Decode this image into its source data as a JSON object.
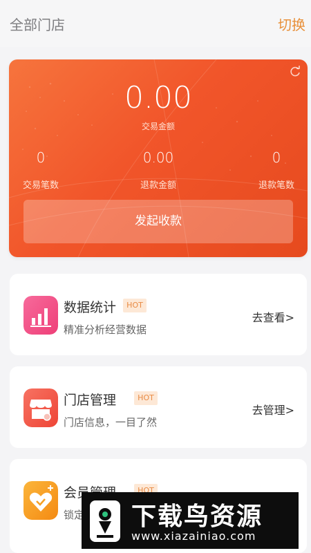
{
  "header": {
    "store_title": "全部门店",
    "switch_label": "切换"
  },
  "summary": {
    "amount_value": "0.00",
    "amount_label": "交易金额",
    "stats": [
      {
        "value": "0",
        "label": "交易笔数"
      },
      {
        "value": "0.00",
        "label": "退款金额"
      },
      {
        "value": "0",
        "label": "退款笔数"
      }
    ],
    "collect_button": "发起收款",
    "refresh_icon": "refresh-icon"
  },
  "menu": [
    {
      "title": "数据统计",
      "badge": "HOT",
      "subtitle": "精准分析经营数据",
      "action": "去查看>",
      "icon": "bar-chart-icon",
      "color": "#f0548a"
    },
    {
      "title": "门店管理",
      "badge": "HOT",
      "subtitle": "门店信息，一目了然",
      "action": "去管理>",
      "icon": "store-icon",
      "color": "#f35a4b"
    },
    {
      "title": "会员管理",
      "badge": "HOT",
      "subtitle": "锁定",
      "action": "",
      "icon": "member-heart-icon",
      "color": "#f7a024"
    }
  ],
  "watermark": {
    "title": "下载鸟资源",
    "url": "www.xiazainiao.com"
  },
  "colors": {
    "accent": "#e8903a",
    "card_gradient_start": "#f6743d",
    "card_gradient_end": "#e64a1e"
  }
}
